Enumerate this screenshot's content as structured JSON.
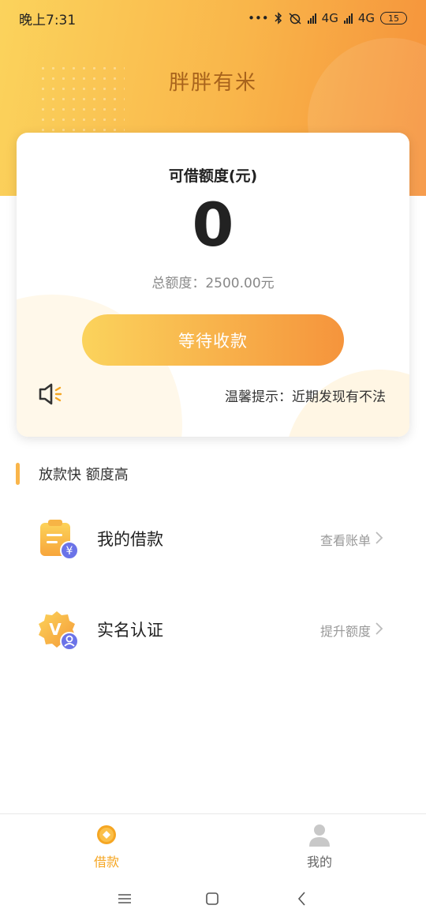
{
  "status_bar": {
    "time": "晚上7:31",
    "dots": "•••",
    "network1": "4G",
    "network2": "4G",
    "battery": "15",
    "icons": [
      "bluetooth-icon",
      "alarm-off-icon",
      "signal-icon",
      "signal-icon",
      "battery-icon"
    ]
  },
  "app": {
    "title": "胖胖有米"
  },
  "quota_card": {
    "label": "可借额度(元)",
    "amount": "0",
    "total": "总额度：2500.00元",
    "button": "等待收款",
    "notice": "温馨提示：近期发现有不法",
    "notice_icon": "speaker-icon"
  },
  "section": {
    "title": "放款快 额度高"
  },
  "menu": [
    {
      "label": "我的借款",
      "action": "查看账单",
      "icon": "loan-clipboard-icon"
    },
    {
      "label": "实名认证",
      "action": "提升额度",
      "icon": "verified-badge-icon"
    }
  ],
  "tabs": [
    {
      "label": "借款",
      "icon": "loan-coin-icon",
      "active": true
    },
    {
      "label": "我的",
      "icon": "user-icon",
      "active": false
    }
  ],
  "colors": {
    "accent": "#f5a623",
    "gradient_start": "#fbd35c",
    "gradient_end": "#f5913a",
    "title_brown": "#a8631c"
  }
}
